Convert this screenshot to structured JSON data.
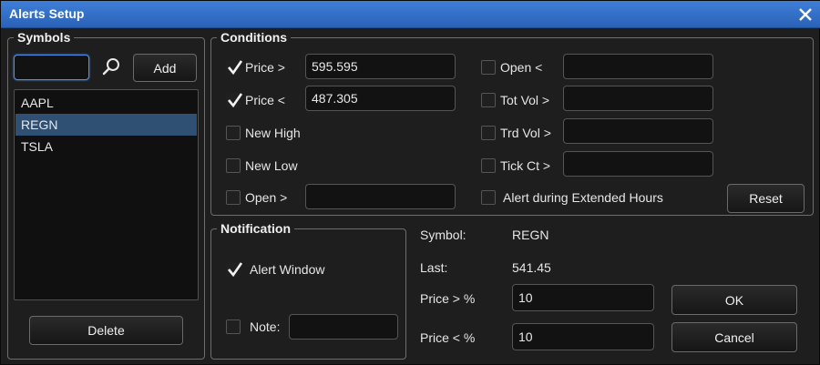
{
  "window": {
    "title": "Alerts Setup"
  },
  "symbols": {
    "legend": "Symbols",
    "search_value": "",
    "add_label": "Add",
    "delete_label": "Delete",
    "items": [
      {
        "label": "AAPL",
        "selected": false
      },
      {
        "label": "REGN",
        "selected": true
      },
      {
        "label": "TSLA",
        "selected": false
      }
    ]
  },
  "conditions": {
    "legend": "Conditions",
    "price_gt": {
      "label": "Price >",
      "checked": true,
      "value": "595.595"
    },
    "price_lt": {
      "label": "Price <",
      "checked": true,
      "value": "487.305"
    },
    "new_high": {
      "label": "New High",
      "checked": false
    },
    "new_low": {
      "label": "New Low",
      "checked": false
    },
    "open_gt": {
      "label": "Open >",
      "checked": false,
      "value": ""
    },
    "open_lt": {
      "label": "Open <",
      "checked": false,
      "value": ""
    },
    "tot_vol": {
      "label": "Tot Vol >",
      "checked": false,
      "value": ""
    },
    "trd_vol": {
      "label": "Trd Vol >",
      "checked": false,
      "value": ""
    },
    "tick_ct": {
      "label": "Tick Ct >",
      "checked": false,
      "value": ""
    },
    "extended_hours": {
      "label": "Alert during Extended Hours",
      "checked": false
    },
    "reset_label": "Reset"
  },
  "notification": {
    "legend": "Notification",
    "alert_window": {
      "label": "Alert Window",
      "checked": true
    },
    "note": {
      "label": "Note:",
      "checked": false,
      "value": ""
    }
  },
  "details": {
    "symbol_label": "Symbol:",
    "symbol_value": "REGN",
    "last_label": "Last:",
    "last_value": "541.45",
    "price_gt_pct_label": "Price > %",
    "price_gt_pct_value": "10",
    "price_lt_pct_label": "Price < %",
    "price_lt_pct_value": "10",
    "ok_label": "OK",
    "cancel_label": "Cancel"
  },
  "colors": {
    "titlebar": "#2f6cc4",
    "selection": "#2f4f73",
    "focus": "#4b8fe8"
  }
}
